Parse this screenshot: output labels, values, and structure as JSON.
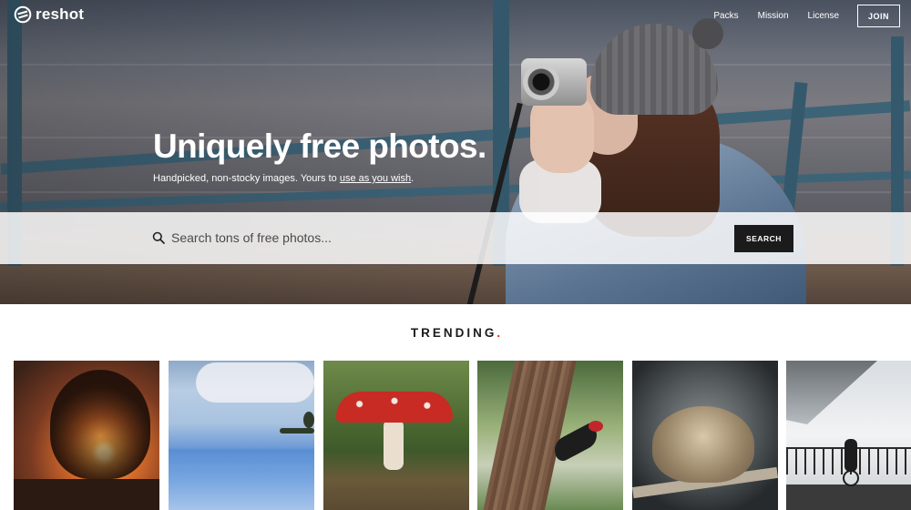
{
  "nav": {
    "logo_text": "reshot",
    "links": [
      "Packs",
      "Mission",
      "License"
    ],
    "join_label": "JOIN"
  },
  "hero": {
    "title": "Uniquely free photos.",
    "subtitle_prefix": "Handpicked, non-stocky images. Yours to ",
    "subtitle_link": "use as you wish",
    "subtitle_suffix": "."
  },
  "search": {
    "placeholder": "Search tons of free photos...",
    "button_label": "SEARCH"
  },
  "trending": {
    "heading": "TRENDING",
    "dot": ".",
    "accent_color": "#e0302a"
  },
  "icons": {
    "logo": "reshot-logo-icon",
    "search": "search-icon"
  }
}
